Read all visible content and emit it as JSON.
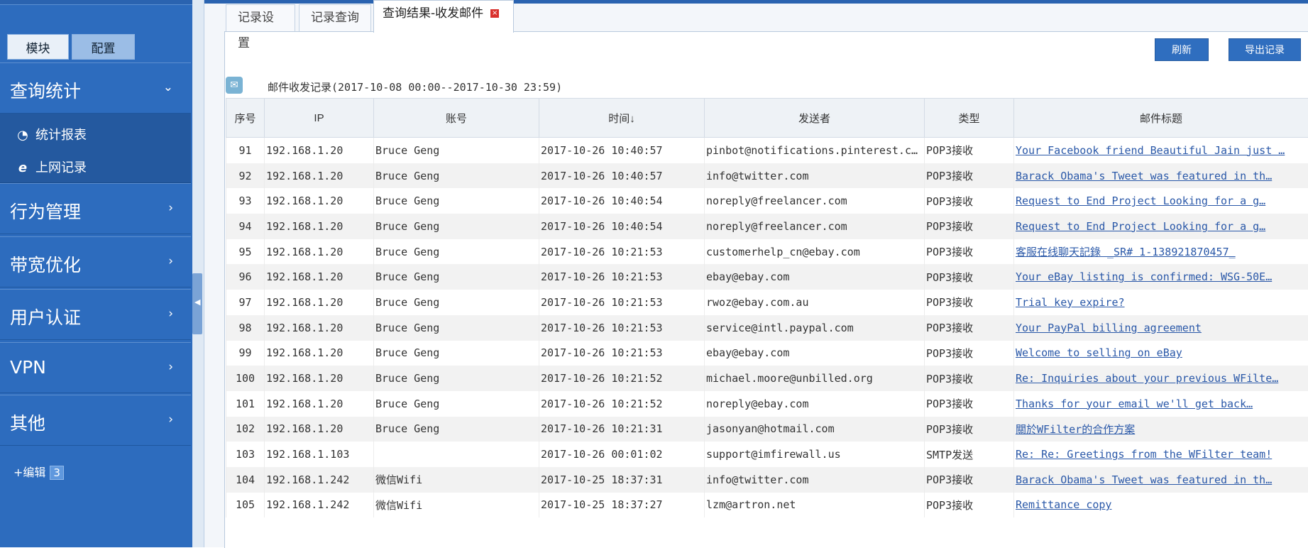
{
  "sidebar": {
    "tabs": {
      "modules": "模块",
      "config": "配置"
    },
    "sections": [
      {
        "label": "查询统计",
        "arrow": "⌄"
      },
      {
        "label": "行为管理",
        "arrow": "›"
      },
      {
        "label": "带宽优化",
        "arrow": "›"
      },
      {
        "label": "用户认证",
        "arrow": "›"
      },
      {
        "label": "VPN",
        "arrow": "›"
      },
      {
        "label": "其他",
        "arrow": "›"
      }
    ],
    "sub_items": [
      {
        "label": "统计报表",
        "icon": "pie-chart-icon"
      },
      {
        "label": "上网记录",
        "icon": "ie-browser-icon"
      }
    ],
    "edit_label": "+编辑",
    "edit_badge": "3"
  },
  "tabs": {
    "record_settings": "记录设置",
    "record_query": "记录查询",
    "result": "查询结果-收发邮件"
  },
  "toolbar": {
    "refresh": "刷新",
    "export": "导出记录"
  },
  "records_title": "邮件收发记录(2017-10-08 00:00--2017-10-30 23:59)",
  "table": {
    "headers": [
      "序号",
      "IP",
      "账号",
      "时间↓",
      "发送者",
      "类型",
      "邮件标题"
    ],
    "rows": [
      {
        "no": "91",
        "ip": "192.168.1.20",
        "account": "Bruce Geng",
        "time": "2017-10-26 10:40:57",
        "sender": "pinbot@notifications.pinterest.com",
        "type": "POP3接收",
        "subject": "Your Facebook friend Beautiful Jain just …"
      },
      {
        "no": "92",
        "ip": "192.168.1.20",
        "account": "Bruce Geng",
        "time": "2017-10-26 10:40:57",
        "sender": "info@twitter.com",
        "type": "POP3接收",
        "subject": "Barack Obama's Tweet was featured in th…"
      },
      {
        "no": "93",
        "ip": "192.168.1.20",
        "account": "Bruce Geng",
        "time": "2017-10-26 10:40:54",
        "sender": "noreply@freelancer.com",
        "type": "POP3接收",
        "subject": "Request to End Project Looking for a g…"
      },
      {
        "no": "94",
        "ip": "192.168.1.20",
        "account": "Bruce Geng",
        "time": "2017-10-26 10:40:54",
        "sender": "noreply@freelancer.com",
        "type": "POP3接收",
        "subject": "Request to End Project Looking for a g…"
      },
      {
        "no": "95",
        "ip": "192.168.1.20",
        "account": "Bruce Geng",
        "time": "2017-10-26 10:21:53",
        "sender": "customerhelp_cn@ebay.com",
        "type": "POP3接收",
        "subject": "客服在线聊天記錄 _SR# 1-138921870457_"
      },
      {
        "no": "96",
        "ip": "192.168.1.20",
        "account": "Bruce Geng",
        "time": "2017-10-26 10:21:53",
        "sender": "ebay@ebay.com",
        "type": "POP3接收",
        "subject": "Your eBay listing is confirmed: WSG-50E…"
      },
      {
        "no": "97",
        "ip": "192.168.1.20",
        "account": "Bruce Geng",
        "time": "2017-10-26 10:21:53",
        "sender": "rwoz@ebay.com.au",
        "type": "POP3接收",
        "subject": "Trial key expire?"
      },
      {
        "no": "98",
        "ip": "192.168.1.20",
        "account": "Bruce Geng",
        "time": "2017-10-26 10:21:53",
        "sender": "service@intl.paypal.com",
        "type": "POP3接收",
        "subject": "Your PayPal billing agreement"
      },
      {
        "no": "99",
        "ip": "192.168.1.20",
        "account": "Bruce Geng",
        "time": "2017-10-26 10:21:53",
        "sender": "ebay@ebay.com",
        "type": "POP3接收",
        "subject": "Welcome to selling on eBay"
      },
      {
        "no": "100",
        "ip": "192.168.1.20",
        "account": "Bruce Geng",
        "time": "2017-10-26 10:21:52",
        "sender": "michael.moore@unbilled.org",
        "type": "POP3接收",
        "subject": "Re: Inquiries about your previous WFilte…"
      },
      {
        "no": "101",
        "ip": "192.168.1.20",
        "account": "Bruce Geng",
        "time": "2017-10-26 10:21:52",
        "sender": "noreply@ebay.com",
        "type": "POP3接收",
        "subject": "Thanks for your email we'll get back…"
      },
      {
        "no": "102",
        "ip": "192.168.1.20",
        "account": "Bruce Geng",
        "time": "2017-10-26 10:21:31",
        "sender": "jasonyan@hotmail.com",
        "type": "POP3接收",
        "subject": "關於WFilter的合作方案"
      },
      {
        "no": "103",
        "ip": "192.168.1.103",
        "account": "",
        "time": "2017-10-26 00:01:02",
        "sender": "support@imfirewall.us",
        "type": "SMTP发送",
        "subject": "Re: Re: Greetings from the WFilter team!"
      },
      {
        "no": "104",
        "ip": "192.168.1.242",
        "account": "微信Wifi",
        "time": "2017-10-25 18:37:31",
        "sender": "info@twitter.com",
        "type": "POP3接收",
        "subject": "Barack Obama's Tweet was featured in th…"
      },
      {
        "no": "105",
        "ip": "192.168.1.242",
        "account": "微信Wifi",
        "time": "2017-10-25 18:37:27",
        "sender": "lzm@artron.net",
        "type": "POP3接收",
        "subject": "Remittance copy"
      }
    ]
  }
}
